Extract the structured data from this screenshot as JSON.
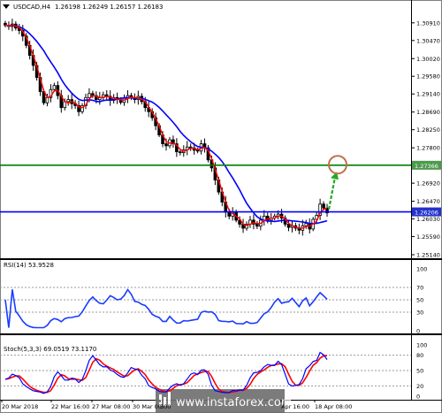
{
  "header": {
    "symbol_label": "USDCAD,H4",
    "ohlc_label": "1.26198 1.26249 1.26157 1.26183",
    "arrow_icon": "triangle-down-icon"
  },
  "main_chart": {
    "price_axis_labels": [
      "1.30910",
      "1.30470",
      "1.30020",
      "1.29580",
      "1.29140",
      "1.28690",
      "1.28250",
      "1.27800",
      "1.26920",
      "1.26470",
      "1.26030",
      "1.25590",
      "1.25140"
    ],
    "level_labels": {
      "resistance": "1.27366",
      "support": "1.26206"
    },
    "colors": {
      "candles": "#000000",
      "ma_fast": "#ff0000",
      "ma_slow": "#0000ff",
      "resistance": "#008000",
      "support": "#0000ff",
      "target_circle": "#c0704a",
      "forecast_arrow": "#22aa22",
      "resistance_tag": "#4d9a4d",
      "support_tag": "#2233cc"
    }
  },
  "rsi_panel": {
    "label": "RSI(14) 53.9528",
    "axis_labels": [
      "100",
      "70",
      "50",
      "30",
      "0"
    ],
    "line_color": "#1a3cff",
    "overlay_color": "#ff0000"
  },
  "stoch_panel": {
    "label": "Stoch(5,3,3) 69.0519 73.1170",
    "axis_labels": [
      "100",
      "80",
      "50",
      "20",
      "0"
    ],
    "main_color": "#0000ff",
    "signal_color": "#ff0000"
  },
  "time_axis": {
    "labels": [
      "20 Mar 2018",
      "22 Mar 16:00",
      "27 Mar 08:00",
      "30 Mar 00:00",
      "3",
      "Apr 16:00",
      "18 Apr 08:00"
    ]
  },
  "watermark": {
    "text": "www.instaforex.com",
    "logo_icon": "instaforex-logo-icon"
  },
  "chart_data": [
    {
      "type": "candlestick",
      "title": "USDCAD,H4",
      "ylim": [
        1.2514,
        1.3117
      ],
      "y_ticks": [
        1.3091,
        1.3047,
        1.3002,
        1.2958,
        1.2914,
        1.2869,
        1.2825,
        1.278,
        1.2692,
        1.2647,
        1.2603,
        1.2559,
        1.2514
      ],
      "close": [
        1.3085,
        1.3082,
        1.3088,
        1.3078,
        1.3072,
        1.3058,
        1.3035,
        1.301,
        1.2985,
        1.2955,
        1.292,
        1.2892,
        1.2905,
        1.2925,
        1.2935,
        1.291,
        1.288,
        1.2895,
        1.29,
        1.289,
        1.2885,
        1.287,
        1.2885,
        1.2905,
        1.2915,
        1.291,
        1.29,
        1.2905,
        1.2912,
        1.2908,
        1.2898,
        1.2905,
        1.29,
        1.2893,
        1.2903,
        1.291,
        1.2905,
        1.29,
        1.2908,
        1.2895,
        1.288,
        1.287,
        1.2855,
        1.2835,
        1.2812,
        1.279,
        1.2785,
        1.28,
        1.279,
        1.277,
        1.2768,
        1.2775,
        1.2782,
        1.278,
        1.2774,
        1.2772,
        1.279,
        1.278,
        1.275,
        1.273,
        1.27,
        1.267,
        1.2645,
        1.262,
        1.261,
        1.262,
        1.26,
        1.259,
        1.258,
        1.259,
        1.26,
        1.259,
        1.2585,
        1.26,
        1.261,
        1.26,
        1.2605,
        1.261,
        1.2615,
        1.2605,
        1.259,
        1.2582,
        1.2586,
        1.258,
        1.2575,
        1.2586,
        1.2592,
        1.2578,
        1.2602,
        1.2612,
        1.264,
        1.263,
        1.2618
      ],
      "resistance": 1.27366,
      "support": 1.26206,
      "target": 1.2738,
      "rsi_period": 14,
      "ma_fast_period": 3,
      "ma_slow_period": 12
    },
    {
      "type": "line",
      "title": "RSI(14) 53.9528",
      "ylim": [
        0,
        100
      ],
      "levels": [
        70,
        50,
        30
      ],
      "last_value": 53.9528
    },
    {
      "type": "line",
      "title": "Stoch(5,3,3) 69.0519 73.1170",
      "ylim": [
        0,
        100
      ],
      "levels": [
        80,
        50,
        20
      ],
      "k_period": 5,
      "d_period": 3,
      "slowing": 3,
      "last_main": 69.0519,
      "last_signal": 73.117
    }
  ]
}
